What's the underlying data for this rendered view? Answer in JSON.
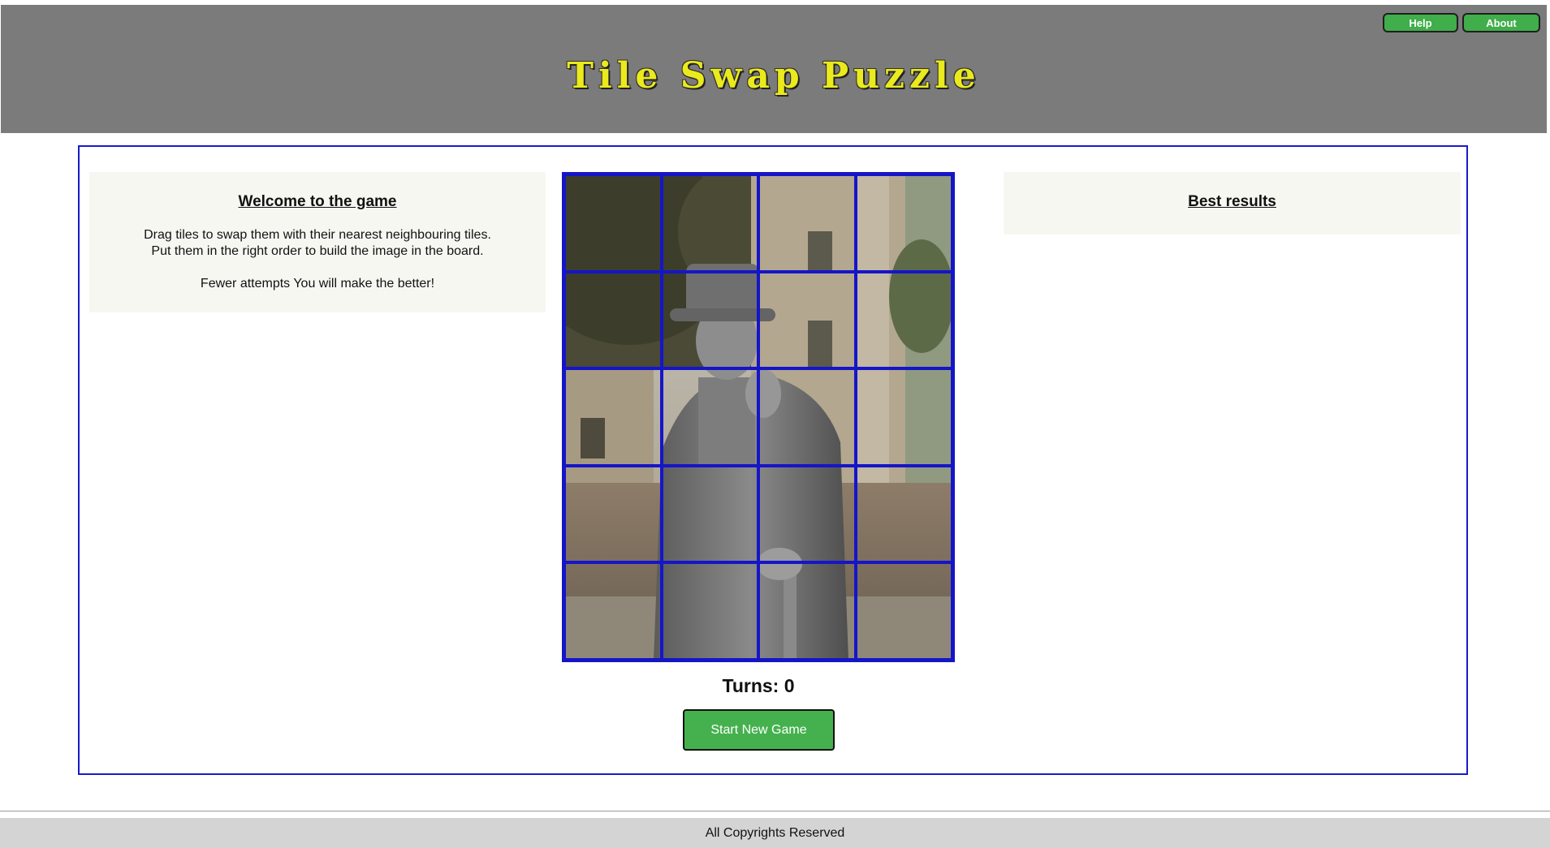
{
  "header": {
    "title": "Tile Swap Puzzle",
    "help_label": "Help",
    "about_label": "About"
  },
  "welcome": {
    "heading": "Welcome to the game",
    "line1": "Drag tiles to swap them with their nearest neighbouring tiles.",
    "line2": "Put them in the right order to build the image in the board.",
    "line3": "Fewer attempts You will make the better!"
  },
  "best": {
    "heading": "Best results"
  },
  "game": {
    "turns_text": "Turns: 0",
    "turns": 0,
    "board_rows": 5,
    "board_cols": 4,
    "start_label": "Start New Game"
  },
  "footer": {
    "text": "All Copyrights Reserved"
  },
  "colors": {
    "header_bg": "#7b7b7b",
    "title": "#eaea1c",
    "button_green": "#45b14e",
    "grid_blue": "#1515c8",
    "panel_bg": "#f7f7f2"
  }
}
